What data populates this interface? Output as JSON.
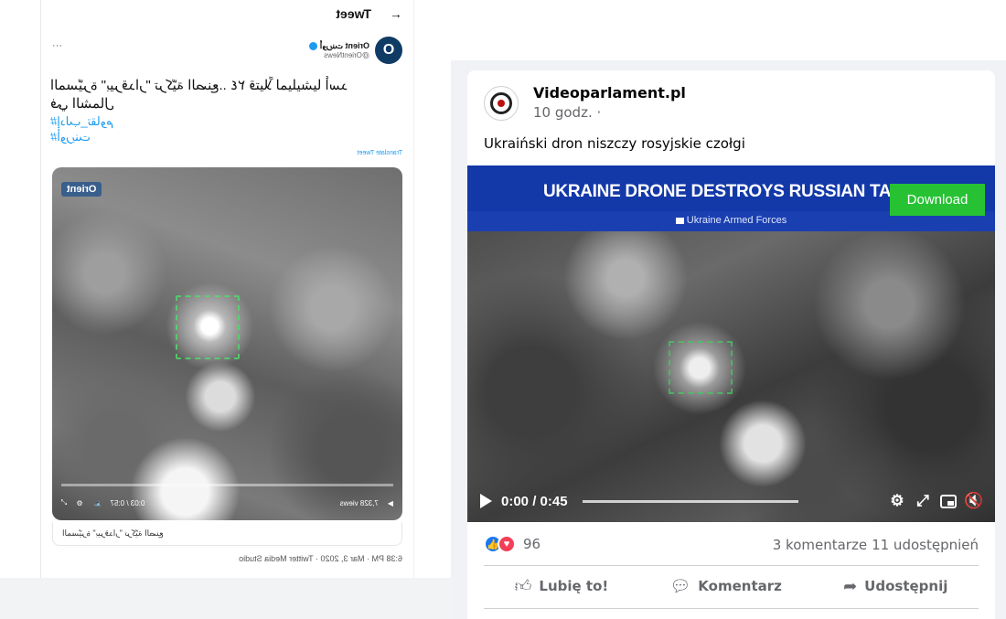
{
  "tweet": {
    "back_icon": "arrow-left-icon",
    "header_title": "Tweet",
    "author_name": "Orient أورينت",
    "author_handle": "@OrientNews",
    "avatar_letter": "O",
    "more_icon": "more-horizontal-icon",
    "text": "المسيّرة \"بيرقدار\" تركيّة الصنع.. ٢٤ قتيلاً لميليشيا أسد",
    "text_line2": "في الشمال",
    "hashtags": [
      "#إدلب_تقاوم",
      "#أورينت"
    ],
    "translate_label": "Translate Tweet",
    "watermark": "Orient",
    "video_time": "0:03 / 0:57",
    "video_views": "7,328 views",
    "caption": "المسيّرة \"بيرقدار\" تركيّة الصنع",
    "meta": "6:38 PM · Mar 3, 2020 · Twitter Media Studio"
  },
  "post": {
    "page_name": "Videoparlament.pl",
    "time": "10 godz. ·",
    "text": "Ukraiński dron niszczy rosyjskie czołgi",
    "video_banner": "UKRAINE DRONE DESTROYS RUSSIAN TAI",
    "video_subbanner": "Ukraine Armed Forces",
    "download_label": "Download",
    "video_time": "0:00 / 0:45",
    "video_progress": 0.0,
    "reaction_count": "96",
    "comments": "3 komentarze",
    "shares": "11 udostępnień",
    "actions": {
      "like": "Lubię to!",
      "comment": "Komentarz",
      "share": "Udostępnij"
    }
  },
  "colors": {
    "fb_blue": "#1877f2",
    "download_green": "#27c234",
    "banner_blue": "#1338a8",
    "twitter_blue": "#1d9bf0"
  }
}
